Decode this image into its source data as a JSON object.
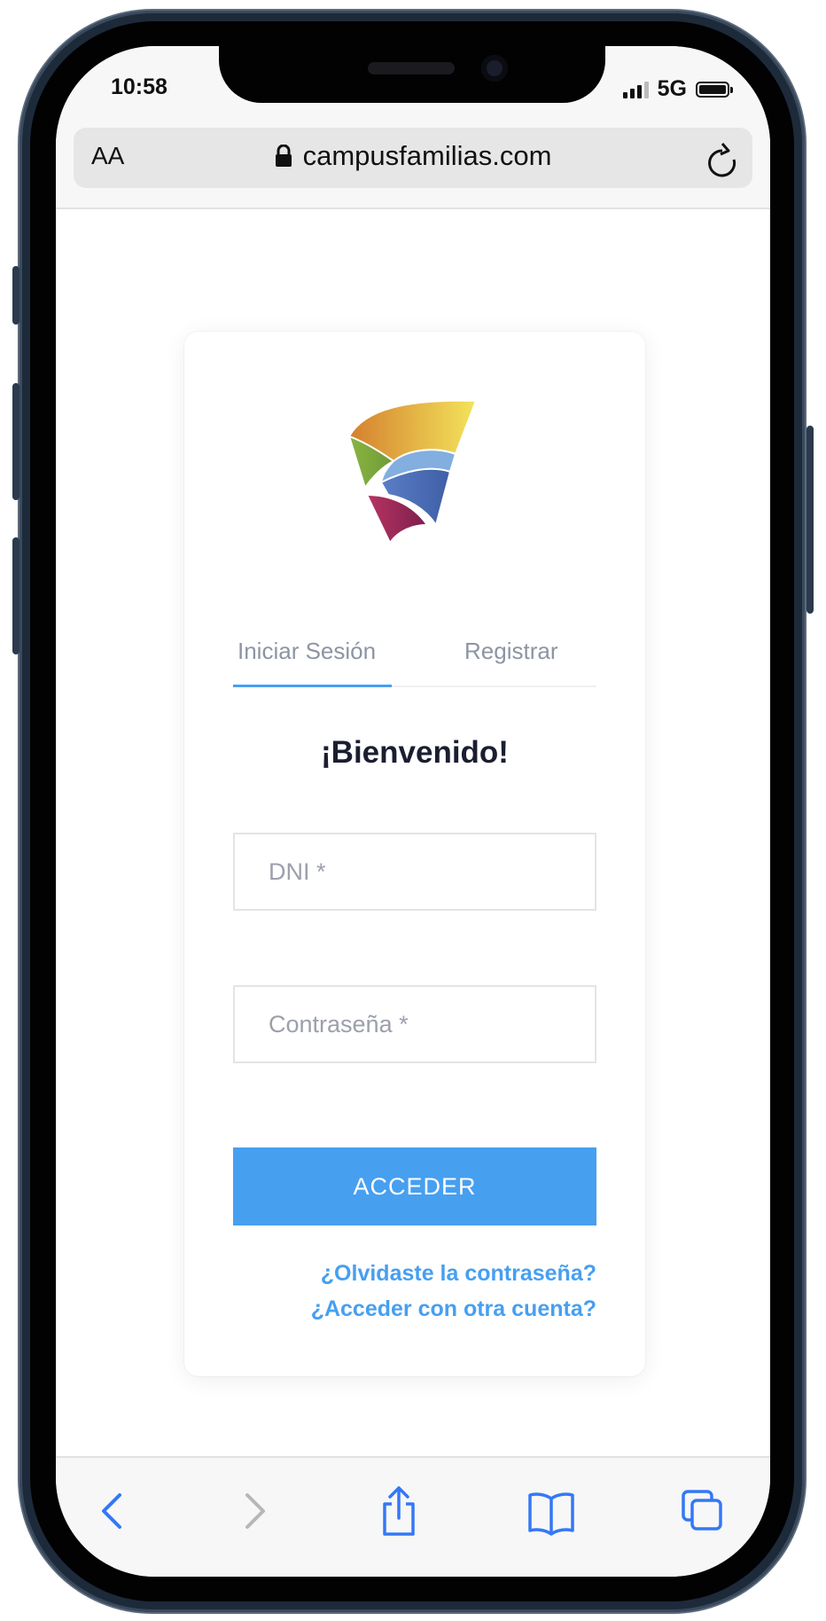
{
  "status_bar": {
    "time": "10:58",
    "network": "5G"
  },
  "browser": {
    "text_size_label": "AA",
    "url": "campusfamilias.com"
  },
  "tabs": [
    {
      "label": "Iniciar Sesión",
      "active": true
    },
    {
      "label": "Registrar",
      "active": false
    }
  ],
  "login": {
    "heading": "¡Bienvenido!",
    "dni_placeholder": "DNI *",
    "password_placeholder": "Contraseña *",
    "submit_label": "ACCEDER",
    "forgot_link": "¿Olvidaste la contraseña?",
    "other_account_link": "¿Acceder con otra cuenta?"
  },
  "toolbar": {
    "icons": [
      "back-icon",
      "forward-icon",
      "share-icon",
      "bookmarks-icon",
      "tabs-icon"
    ]
  },
  "colors": {
    "accent": "#479ff0",
    "heading": "#1a1e30",
    "muted_text": "#8d95a3",
    "ios_blue": "#3478f6"
  }
}
